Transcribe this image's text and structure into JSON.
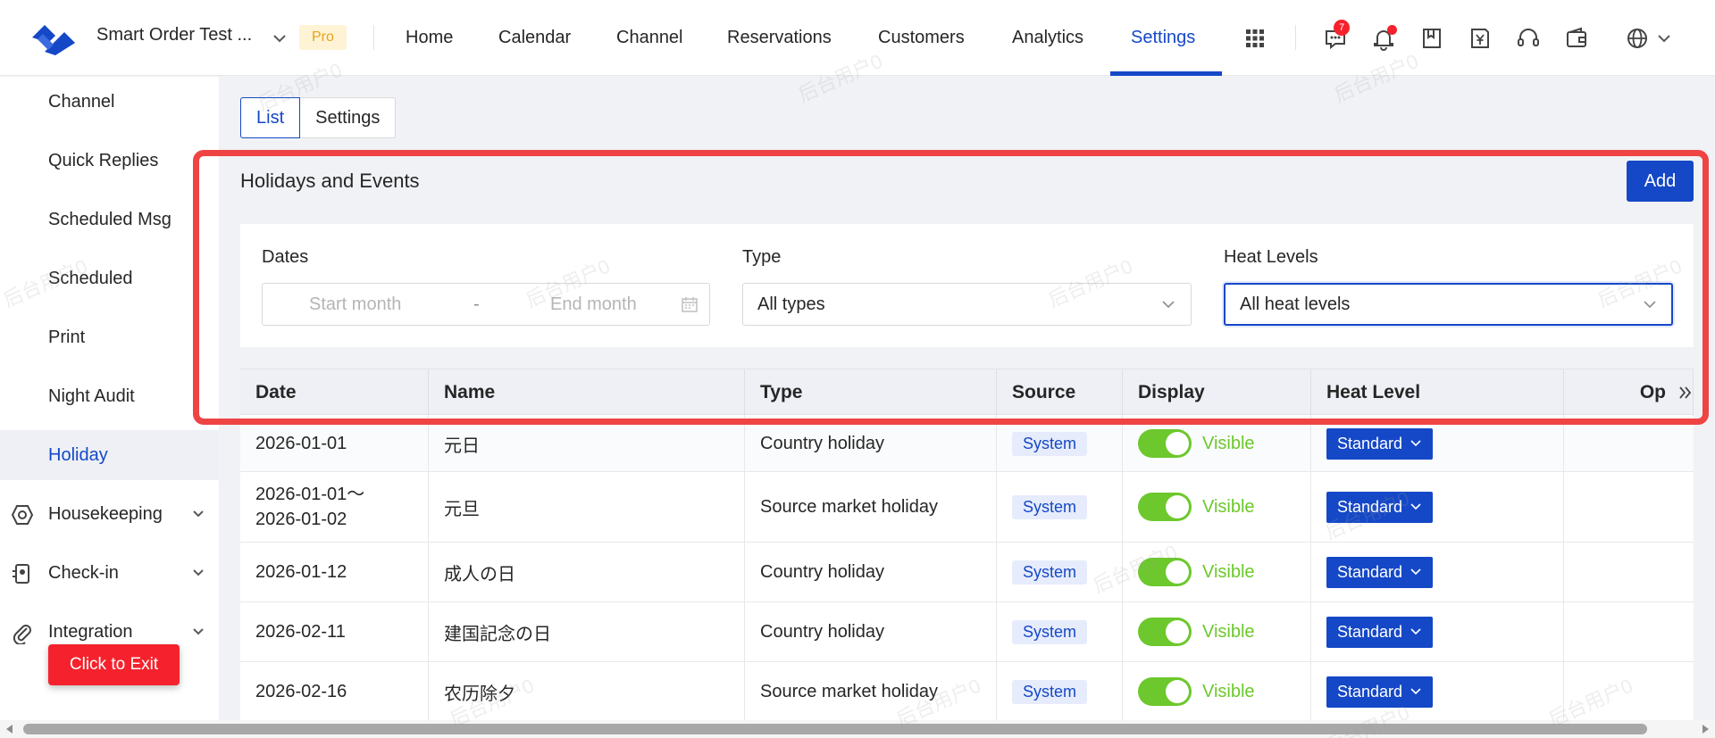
{
  "topbar": {
    "org_name": "Smart Order Test ...",
    "pro_badge": "Pro",
    "nav": [
      "Home",
      "Calendar",
      "Channel",
      "Reservations",
      "Customers",
      "Analytics",
      "Settings"
    ],
    "active_nav": "Settings",
    "message_count": "7"
  },
  "sidebar": {
    "items": [
      "Channel",
      "Quick Replies",
      "Scheduled Msg",
      "Scheduled",
      "Print",
      "Night Audit",
      "Holiday"
    ],
    "active_item": "Holiday",
    "groups": [
      "Housekeeping",
      "Check-in",
      "Integration"
    ],
    "exit_label": "Click to Exit"
  },
  "tabs": [
    "List",
    "Settings"
  ],
  "section": {
    "title": "Holidays and Events",
    "add_label": "Add"
  },
  "filters": {
    "dates_label": "Dates",
    "start_placeholder": "Start month",
    "separator": "-",
    "end_placeholder": "End month",
    "type_label": "Type",
    "type_value": "All types",
    "heat_label": "Heat Levels",
    "heat_value": "All heat levels"
  },
  "table": {
    "columns": [
      "Date",
      "Name",
      "Type",
      "Source",
      "Display",
      "Heat Level",
      "Op"
    ],
    "rows": [
      {
        "date": "2026-01-01",
        "name": "元日",
        "type": "Country holiday",
        "source": "System",
        "display": "Visible",
        "heat": "Standard"
      },
      {
        "date": "2026-01-01～\n2026-01-02",
        "name": "元旦",
        "type": "Source market holiday",
        "source": "System",
        "display": "Visible",
        "heat": "Standard"
      },
      {
        "date": "2026-01-12",
        "name": "成人の日",
        "type": "Country holiday",
        "source": "System",
        "display": "Visible",
        "heat": "Standard"
      },
      {
        "date": "2026-02-11",
        "name": "建国記念の日",
        "type": "Country holiday",
        "source": "System",
        "display": "Visible",
        "heat": "Standard"
      },
      {
        "date": "2026-02-16",
        "name": "农历除夕",
        "type": "Source market holiday",
        "source": "System",
        "display": "Visible",
        "heat": "Standard"
      }
    ]
  },
  "watermark": "后台用户0",
  "colors": {
    "accent": "#1548c7",
    "danger": "#f5222d",
    "switch_on": "#6cc82c",
    "highlight": "#ef4444"
  }
}
